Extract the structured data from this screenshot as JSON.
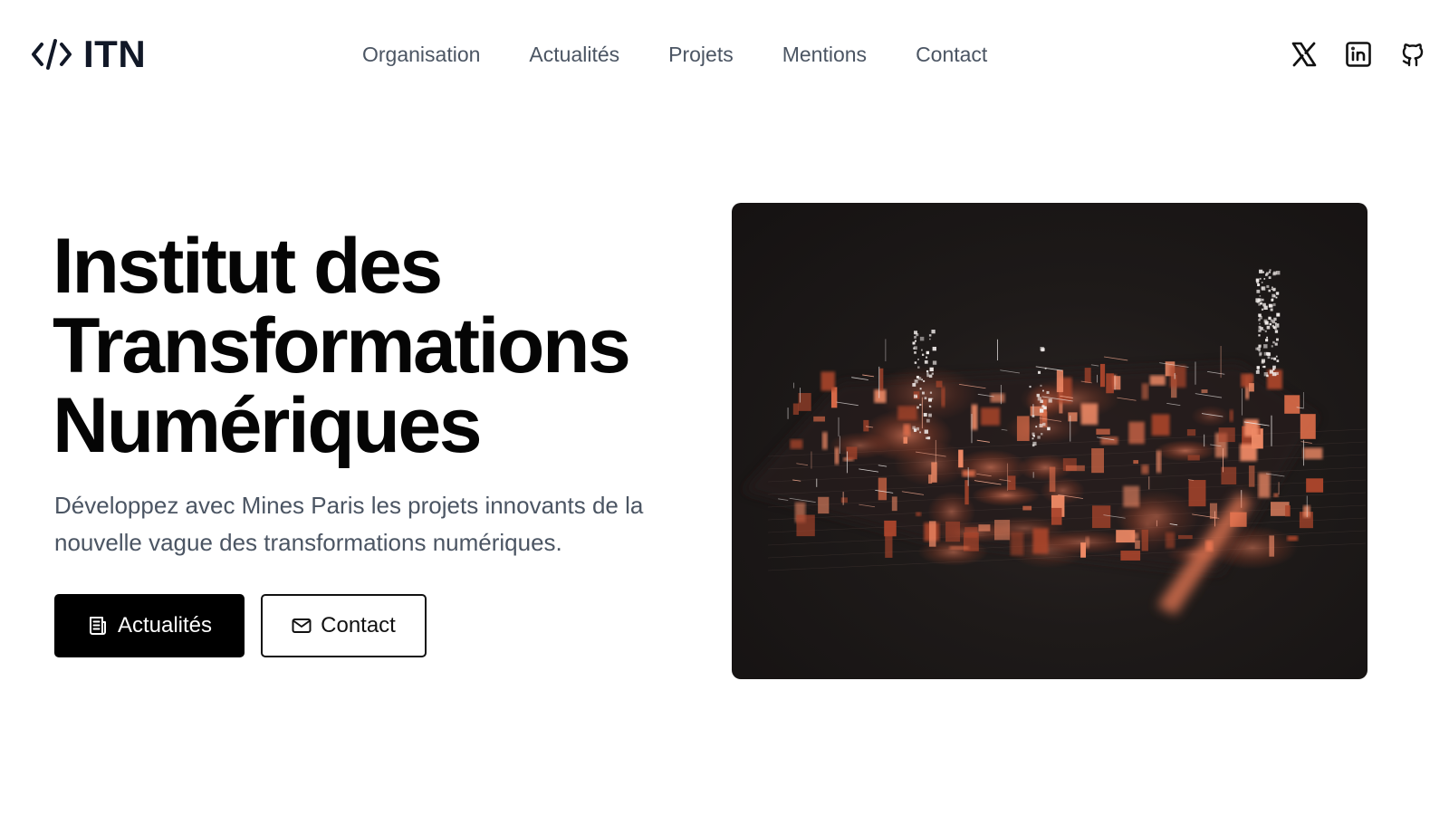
{
  "header": {
    "logo_text": "ITN",
    "nav": [
      {
        "label": "Organisation"
      },
      {
        "label": "Actualités"
      },
      {
        "label": "Projets"
      },
      {
        "label": "Mentions"
      },
      {
        "label": "Contact"
      }
    ],
    "social": [
      {
        "icon": "x-twitter-icon"
      },
      {
        "icon": "linkedin-icon"
      },
      {
        "icon": "github-icon"
      }
    ]
  },
  "hero": {
    "title_lines": [
      "Institut des",
      "Transformations",
      "Numériques"
    ],
    "subtitle": "Développez avec Mines Paris les projets innovants de la nouvelle vague des transformations numériques.",
    "primary_button": {
      "label": "Actualités",
      "icon": "newspaper-icon"
    },
    "secondary_button": {
      "label": "Contact",
      "icon": "mail-icon"
    }
  },
  "colors": {
    "primary_button_bg": "#000000",
    "nav_text": "#4b5563",
    "image_bg": "#1e1a19",
    "image_accent": "#e0694a"
  }
}
